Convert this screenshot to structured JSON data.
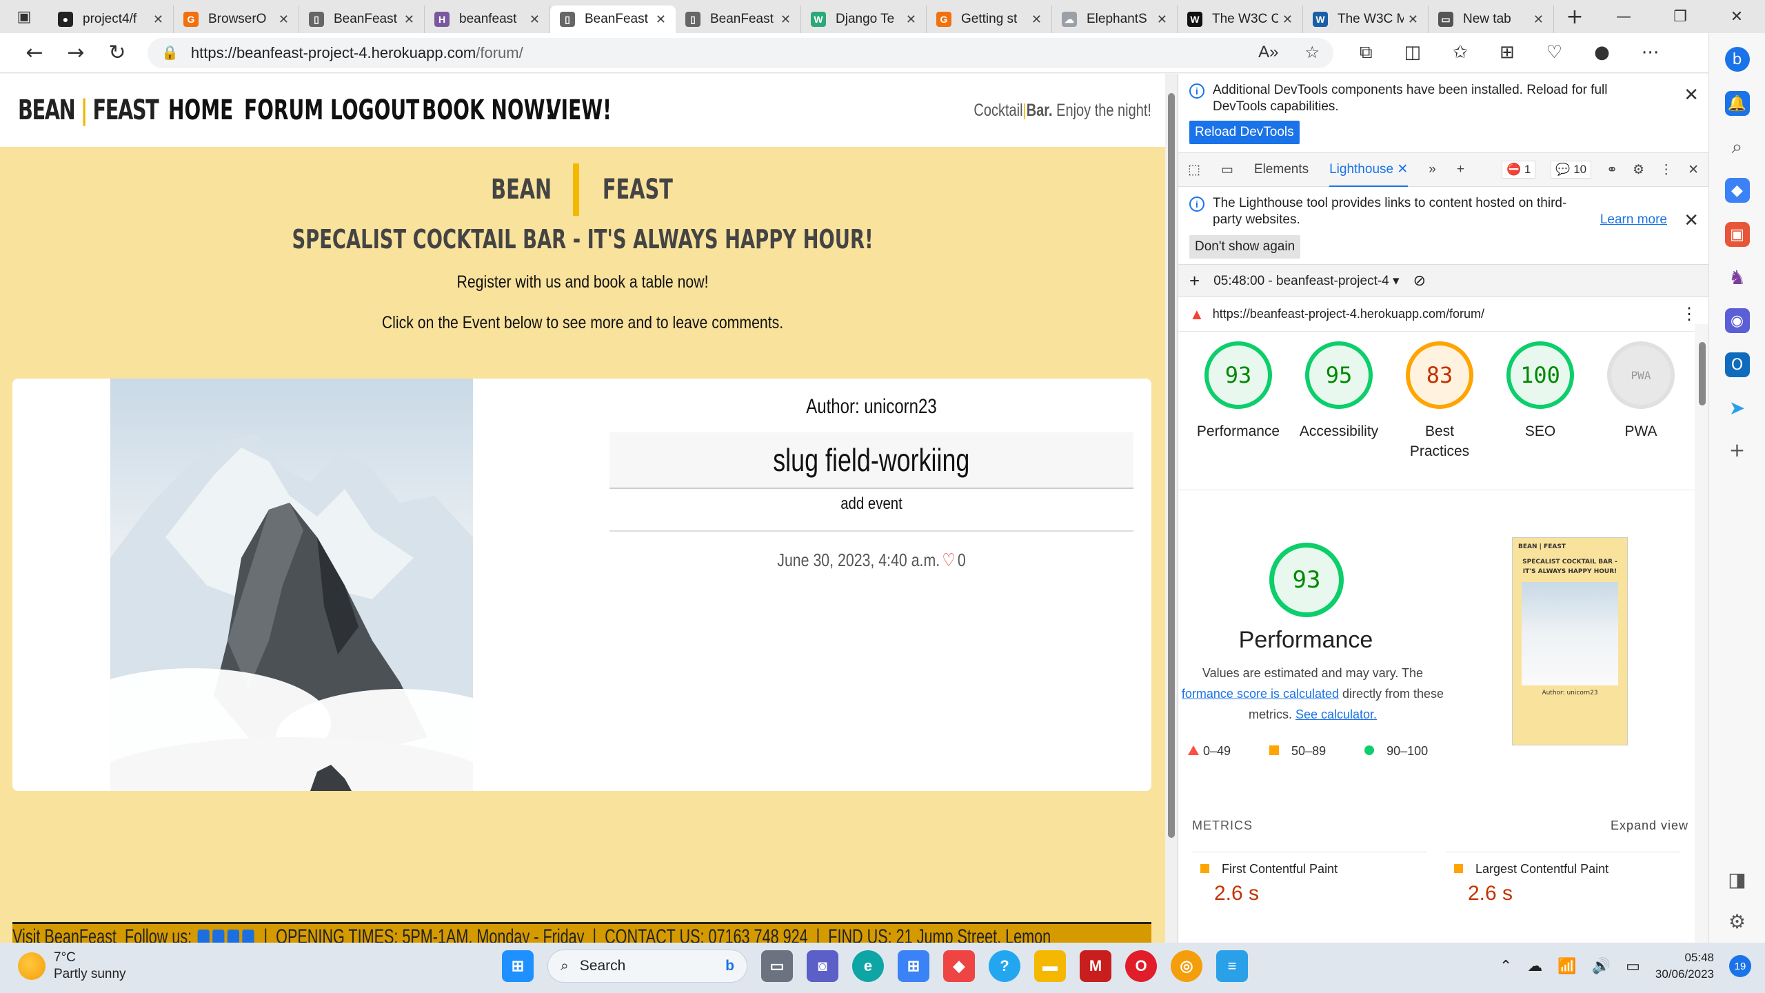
{
  "browser": {
    "tabs": [
      {
        "title": "project4/f",
        "fav_color": "#222222",
        "fav_glyph": "●"
      },
      {
        "title": "BrowserO",
        "fav_color": "#f2700d",
        "fav_glyph": "G"
      },
      {
        "title": "BeanFeast",
        "fav_color": "#666666",
        "fav_glyph": "▯"
      },
      {
        "title": "beanfeast",
        "fav_color": "#79589f",
        "fav_glyph": "H"
      },
      {
        "title": "BeanFeast",
        "fav_color": "#666666",
        "fav_glyph": "▯"
      },
      {
        "title": "BeanFeast",
        "fav_color": "#666666",
        "fav_glyph": "▯"
      },
      {
        "title": "Django Te",
        "fav_color": "#2ba977",
        "fav_glyph": "W"
      },
      {
        "title": "Getting st",
        "fav_color": "#f2700d",
        "fav_glyph": "G"
      },
      {
        "title": "ElephantS",
        "fav_color": "#9aa0a6",
        "fav_glyph": "☁"
      },
      {
        "title": "The W3C C",
        "fav_color": "#111111",
        "fav_glyph": "W"
      },
      {
        "title": "The W3C M",
        "fav_color": "#1a5ea8",
        "fav_glyph": "W"
      },
      {
        "title": "New tab",
        "fav_color": "#555555",
        "fav_glyph": "▭"
      }
    ],
    "url_host": "https://beanfeast-project-4.herokuapp.com",
    "url_path": "/forum/"
  },
  "site": {
    "brand_bean": "BEAN",
    "brand_sep": "|",
    "brand_feast": "FEAST",
    "nav": [
      "HOME",
      "FORUM",
      "LOGOUT",
      "BOOK NOW!",
      "VIEW!"
    ],
    "tagline_a": "Cocktail",
    "tagline_sep": "|",
    "tagline_b": "Bar.",
    "tagline_c": " Enjoy the night!",
    "hero_bean": "BEAN",
    "hero_feast": "FEAST",
    "hero_sub": "SPECALIST COCKTAIL BAR - IT'S ALWAYS HAPPY HOUR!",
    "hero_p1": "Register with us and book a table now!",
    "hero_p2": "Click on the Event below to see more and to leave comments.",
    "event": {
      "author": "Author: unicorn23",
      "title": "slug field-workiing",
      "excerpt": "add event",
      "date": "June 30, 2023, 4:40 a.m.",
      "likes": "0"
    },
    "footer": {
      "visit": "Visit BeanFeast",
      "follow": "Follow us:",
      "opening": "OPENING TIMES: 5PM-1AM, Monday - Friday",
      "contact": "CONTACT US: 07163 748 924",
      "find": "FIND US: 21 Jump Street, Lemon"
    }
  },
  "devtools": {
    "banner": "Additional DevTools components have been installed. Reload for full DevTools capabilities.",
    "reload_btn": "Reload DevTools",
    "tab_elements": "Elements",
    "tab_lighthouse": "Lighthouse",
    "errors": "1",
    "messages": "10",
    "lh_notice": "The Lighthouse tool provides links to content hosted on third-party websites.",
    "learn_more": "Learn more",
    "dont_show": "Don't show again",
    "report_name": "05:48:00 - beanfeast-project-4",
    "report_url": "https://beanfeast-project-4.herokuapp.com/forum/",
    "scores": [
      {
        "value": "93",
        "label": "Performance",
        "tone": "green"
      },
      {
        "value": "95",
        "label": "Accessibility",
        "tone": "green"
      },
      {
        "value": "83",
        "label": "Best Practices",
        "tone": "orange"
      },
      {
        "value": "100",
        "label": "SEO",
        "tone": "green"
      },
      {
        "value": "PWA",
        "label": "PWA",
        "tone": "grey"
      }
    ],
    "perf_score": "93",
    "perf_title": "Performance",
    "perf_desc_1": "Values are estimated and may vary. The ",
    "perf_link_1": "formance score is calculated",
    "perf_desc_2": " directly from these metrics. ",
    "perf_link_2": "See calculator.",
    "legend": [
      "0–49",
      "50–89",
      "90–100"
    ],
    "metrics_label": "METRICS",
    "expand": "Expand view",
    "metrics": [
      {
        "name": "First Contentful Paint",
        "value": "2.6 s"
      },
      {
        "name": "Largest Contentful Paint",
        "value": "2.6 s"
      }
    ],
    "thumb_text_1": "BEAN | FEAST",
    "thumb_text_2": "SPECALIST COCKTAIL BAR - IT'S ALWAYS HAPPY HOUR!",
    "thumb_text_3": "Author: unicorn23"
  },
  "taskbar": {
    "temp": "7°C",
    "weather": "Partly sunny",
    "search": "Search",
    "time": "05:48",
    "date": "30/06/2023",
    "notifications": "19"
  }
}
